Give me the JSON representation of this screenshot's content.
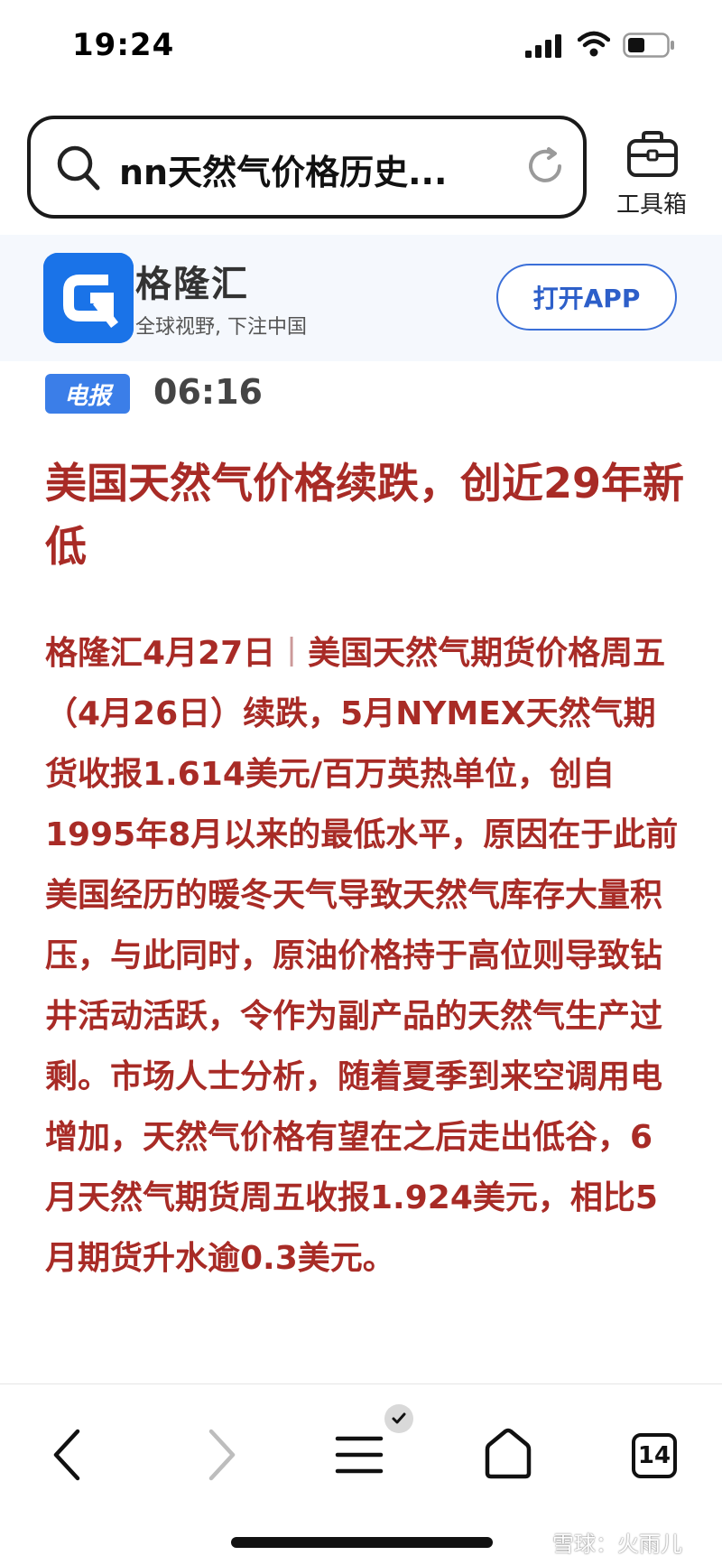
{
  "status_bar": {
    "time": "19:24"
  },
  "search": {
    "query": "nn天然气价格历史..."
  },
  "toolbox": {
    "label": "工具箱"
  },
  "app_banner": {
    "name": "格隆汇",
    "slogan": "全球视野, 下注中国",
    "open_button": "打开APP",
    "brand_color": "#1a73e8"
  },
  "article": {
    "tag": "电报",
    "time": "06:16",
    "headline": "美国天然气价格续跌，创近29年新低",
    "source_date": "格隆汇4月27日",
    "separator": "丨",
    "body": "美国天然气期货价格周五（4月26日）续跌，5月NYMEX天然气期货收报1.614美元/百万英热单位，创自1995年8月以来的最低水平，原因在于此前美国经历的暖冬天气导致天然气库存大量积压，与此同时，原油价格持于高位则导致钻井活动活跃，令作为副产品的天然气生产过剩。市场人士分析，随着夏季到来空调用电增加，天然气价格有望在之后走出低谷，6月天然气期货周五收报1.924美元，相比5月期货升水逾0.3美元。",
    "text_color": "#a82b26"
  },
  "bottom_nav": {
    "tab_count": "14",
    "icons": [
      "back-icon",
      "forward-icon",
      "menu-icon",
      "home-icon",
      "tabs-icon"
    ]
  },
  "watermark": "雪球：火雨儿"
}
